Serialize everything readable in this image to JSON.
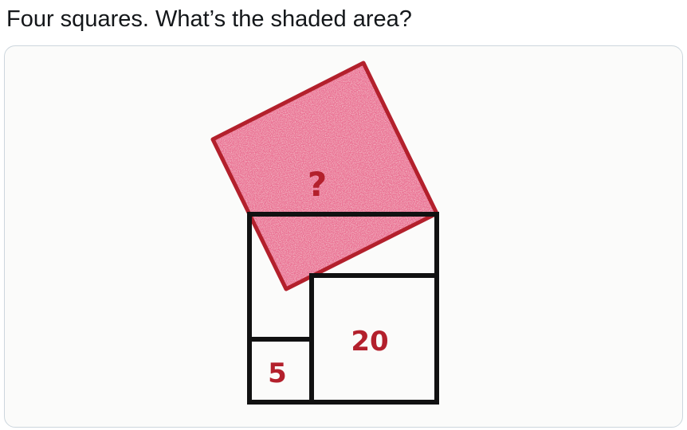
{
  "tweet": {
    "text": "Four squares. What’s the shaded area?"
  },
  "figure": {
    "shaded_square_label": "?",
    "large_square_label": "20",
    "small_square_label": "5",
    "colors": {
      "shaded_fill": "#ea6f93",
      "shaded_outline": "#b3202c",
      "label_color": "#b3202c",
      "line_color": "#111111",
      "card_border": "#ccd6dd",
      "text_color": "#14171a"
    }
  }
}
